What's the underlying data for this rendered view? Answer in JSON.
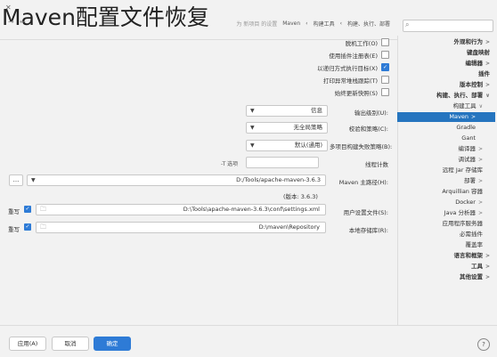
{
  "page": {
    "title": "Maven配置文件恢复"
  },
  "header": {
    "breadcrumb": [
      "构建、执行、部署",
      "构建工具",
      "Maven"
    ],
    "breadcrumb_note": "为 新项目 的设置",
    "nav_back": "←",
    "nav_forward": "→"
  },
  "sidebar": {
    "search_placeholder": "",
    "items": [
      {
        "label": "外观和行为",
        "arrow": ">",
        "bold": true
      },
      {
        "label": "键盘映射",
        "arrow": "",
        "bold": true
      },
      {
        "label": "编辑器",
        "arrow": ">",
        "bold": true
      },
      {
        "label": "插件",
        "arrow": "",
        "bold": true
      },
      {
        "label": "版本控制",
        "arrow": ">",
        "bold": true
      },
      {
        "label": "构建、执行、部署",
        "arrow": "∨",
        "bold": true
      },
      {
        "label": "构建工具",
        "arrow": "∨",
        "bold": false
      },
      {
        "label": "Maven",
        "arrow": ">",
        "bold": false,
        "selected": true
      },
      {
        "label": "Gradle",
        "arrow": "",
        "bold": false
      },
      {
        "label": "Gant",
        "arrow": "",
        "bold": false
      },
      {
        "label": "编译器",
        "arrow": ">",
        "bold": false
      },
      {
        "label": "调试器",
        "arrow": ">",
        "bold": false
      },
      {
        "label": "远程 Jar 存储库",
        "arrow": "",
        "bold": false
      },
      {
        "label": "部署",
        "arrow": ">",
        "bold": false
      },
      {
        "label": "Arquillian 容器",
        "arrow": "",
        "bold": false
      },
      {
        "label": "Docker",
        "arrow": ">",
        "bold": false
      },
      {
        "label": "Java 分析器",
        "arrow": ">",
        "bold": false
      },
      {
        "label": "应用程序服务器",
        "arrow": "",
        "bold": false
      },
      {
        "label": "必需插件",
        "arrow": "",
        "bold": false
      },
      {
        "label": "覆盖率",
        "arrow": "",
        "bold": false
      },
      {
        "label": "语言和框架",
        "arrow": ">",
        "bold": true
      },
      {
        "label": "工具",
        "arrow": ">",
        "bold": true
      },
      {
        "label": "其他设置",
        "arrow": ">",
        "bold": true
      }
    ]
  },
  "options": {
    "work_offline": "脱机工作(O)",
    "use_plugin_registry": "使用插件注册表(E)",
    "execute_recursive": "以递归方式执行目标(X)",
    "print_exception_stack": "打印异常堆栈跟踪(T)",
    "always_update_snapshots": "始终更新快照(S)",
    "checked": [
      false,
      false,
      true,
      false,
      false
    ]
  },
  "fields": {
    "output_level_label": "输出级别(U):",
    "output_level_value": "信息",
    "checksum_policy_label": "校验和策略(C):",
    "checksum_policy_value": "无全局策略",
    "multiproject_label": "多项目构建失败策略(B):",
    "multiproject_value": "默认(通用)",
    "threads_label": "线程计数",
    "threads_value": "",
    "threads_hint": "-T 选项",
    "maven_home_label": "Maven 主路径(H):",
    "maven_home_value": "D:/Tools/apache-maven-3.6.3",
    "version_text": "(版本: 3.6.3)",
    "settings_file_label": "用户设置文件(S):",
    "settings_file_value": "D:\\Tools\\apache-maven-3.6.3\\conf\\settings.xml",
    "settings_override": "重写",
    "local_repo_label": "本地存储库(R):",
    "local_repo_value": "D:\\maven\\Repository",
    "local_repo_override": "重写",
    "browse_label": "..."
  },
  "footer": {
    "ok": "确定",
    "cancel": "取消",
    "apply": "应用(A)",
    "help": "?"
  },
  "colors": {
    "accent": "#2e7bd6",
    "selected": "#2675bf"
  }
}
